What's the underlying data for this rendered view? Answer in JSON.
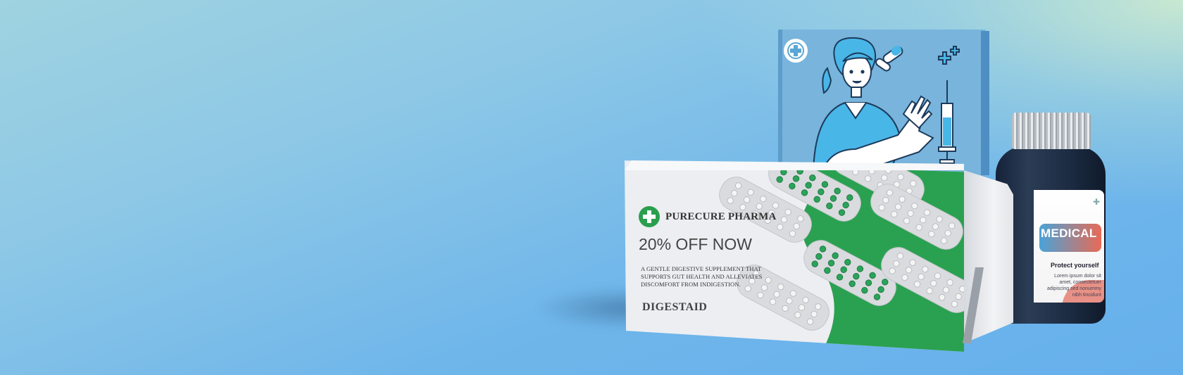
{
  "scene": {
    "background_color": "#6fb6ea",
    "accent_green": "#2a9f4e"
  },
  "front_box": {
    "brand": "PURECURE PHARMA",
    "offer": "20% OFF NOW",
    "description": "A GENTLE DIGESTIVE SUPPLEMENT THAT SUPPORTS GUT HEALTH AND ALLEVIATES DISCOMFORT FROM INDIGESTION.",
    "product_name": "DIGESTAID"
  },
  "bottle": {
    "label_title": "MEDICAL",
    "label_subtitle": "Protect yourself",
    "label_text": "Lorem ipsum dolor sit amet, consectetuer adipiscing sed nonummy nibh tincidunt"
  },
  "icons": [
    "medical-cross-icon",
    "capsule-icon",
    "syringe-icon",
    "nurse-illustration"
  ]
}
